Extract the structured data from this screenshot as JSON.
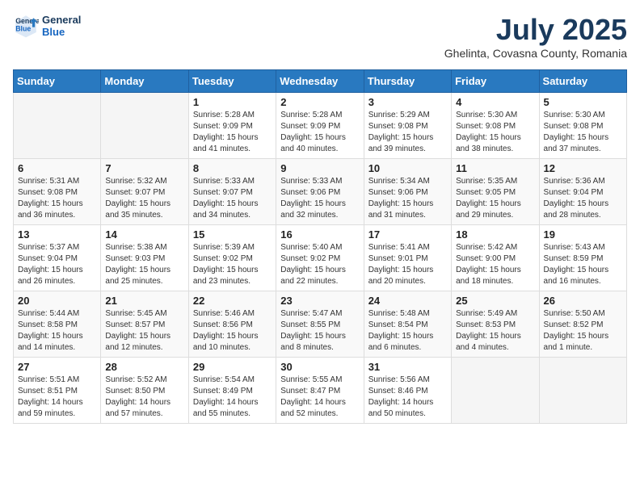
{
  "header": {
    "logo_line1": "General",
    "logo_line2": "Blue",
    "month_year": "July 2025",
    "location": "Ghelinta, Covasna County, Romania"
  },
  "weekdays": [
    "Sunday",
    "Monday",
    "Tuesday",
    "Wednesday",
    "Thursday",
    "Friday",
    "Saturday"
  ],
  "weeks": [
    [
      {
        "day": "",
        "info": ""
      },
      {
        "day": "",
        "info": ""
      },
      {
        "day": "1",
        "info": "Sunrise: 5:28 AM\nSunset: 9:09 PM\nDaylight: 15 hours and 41 minutes."
      },
      {
        "day": "2",
        "info": "Sunrise: 5:28 AM\nSunset: 9:09 PM\nDaylight: 15 hours and 40 minutes."
      },
      {
        "day": "3",
        "info": "Sunrise: 5:29 AM\nSunset: 9:08 PM\nDaylight: 15 hours and 39 minutes."
      },
      {
        "day": "4",
        "info": "Sunrise: 5:30 AM\nSunset: 9:08 PM\nDaylight: 15 hours and 38 minutes."
      },
      {
        "day": "5",
        "info": "Sunrise: 5:30 AM\nSunset: 9:08 PM\nDaylight: 15 hours and 37 minutes."
      }
    ],
    [
      {
        "day": "6",
        "info": "Sunrise: 5:31 AM\nSunset: 9:08 PM\nDaylight: 15 hours and 36 minutes."
      },
      {
        "day": "7",
        "info": "Sunrise: 5:32 AM\nSunset: 9:07 PM\nDaylight: 15 hours and 35 minutes."
      },
      {
        "day": "8",
        "info": "Sunrise: 5:33 AM\nSunset: 9:07 PM\nDaylight: 15 hours and 34 minutes."
      },
      {
        "day": "9",
        "info": "Sunrise: 5:33 AM\nSunset: 9:06 PM\nDaylight: 15 hours and 32 minutes."
      },
      {
        "day": "10",
        "info": "Sunrise: 5:34 AM\nSunset: 9:06 PM\nDaylight: 15 hours and 31 minutes."
      },
      {
        "day": "11",
        "info": "Sunrise: 5:35 AM\nSunset: 9:05 PM\nDaylight: 15 hours and 29 minutes."
      },
      {
        "day": "12",
        "info": "Sunrise: 5:36 AM\nSunset: 9:04 PM\nDaylight: 15 hours and 28 minutes."
      }
    ],
    [
      {
        "day": "13",
        "info": "Sunrise: 5:37 AM\nSunset: 9:04 PM\nDaylight: 15 hours and 26 minutes."
      },
      {
        "day": "14",
        "info": "Sunrise: 5:38 AM\nSunset: 9:03 PM\nDaylight: 15 hours and 25 minutes."
      },
      {
        "day": "15",
        "info": "Sunrise: 5:39 AM\nSunset: 9:02 PM\nDaylight: 15 hours and 23 minutes."
      },
      {
        "day": "16",
        "info": "Sunrise: 5:40 AM\nSunset: 9:02 PM\nDaylight: 15 hours and 22 minutes."
      },
      {
        "day": "17",
        "info": "Sunrise: 5:41 AM\nSunset: 9:01 PM\nDaylight: 15 hours and 20 minutes."
      },
      {
        "day": "18",
        "info": "Sunrise: 5:42 AM\nSunset: 9:00 PM\nDaylight: 15 hours and 18 minutes."
      },
      {
        "day": "19",
        "info": "Sunrise: 5:43 AM\nSunset: 8:59 PM\nDaylight: 15 hours and 16 minutes."
      }
    ],
    [
      {
        "day": "20",
        "info": "Sunrise: 5:44 AM\nSunset: 8:58 PM\nDaylight: 15 hours and 14 minutes."
      },
      {
        "day": "21",
        "info": "Sunrise: 5:45 AM\nSunset: 8:57 PM\nDaylight: 15 hours and 12 minutes."
      },
      {
        "day": "22",
        "info": "Sunrise: 5:46 AM\nSunset: 8:56 PM\nDaylight: 15 hours and 10 minutes."
      },
      {
        "day": "23",
        "info": "Sunrise: 5:47 AM\nSunset: 8:55 PM\nDaylight: 15 hours and 8 minutes."
      },
      {
        "day": "24",
        "info": "Sunrise: 5:48 AM\nSunset: 8:54 PM\nDaylight: 15 hours and 6 minutes."
      },
      {
        "day": "25",
        "info": "Sunrise: 5:49 AM\nSunset: 8:53 PM\nDaylight: 15 hours and 4 minutes."
      },
      {
        "day": "26",
        "info": "Sunrise: 5:50 AM\nSunset: 8:52 PM\nDaylight: 15 hours and 1 minute."
      }
    ],
    [
      {
        "day": "27",
        "info": "Sunrise: 5:51 AM\nSunset: 8:51 PM\nDaylight: 14 hours and 59 minutes."
      },
      {
        "day": "28",
        "info": "Sunrise: 5:52 AM\nSunset: 8:50 PM\nDaylight: 14 hours and 57 minutes."
      },
      {
        "day": "29",
        "info": "Sunrise: 5:54 AM\nSunset: 8:49 PM\nDaylight: 14 hours and 55 minutes."
      },
      {
        "day": "30",
        "info": "Sunrise: 5:55 AM\nSunset: 8:47 PM\nDaylight: 14 hours and 52 minutes."
      },
      {
        "day": "31",
        "info": "Sunrise: 5:56 AM\nSunset: 8:46 PM\nDaylight: 14 hours and 50 minutes."
      },
      {
        "day": "",
        "info": ""
      },
      {
        "day": "",
        "info": ""
      }
    ]
  ]
}
